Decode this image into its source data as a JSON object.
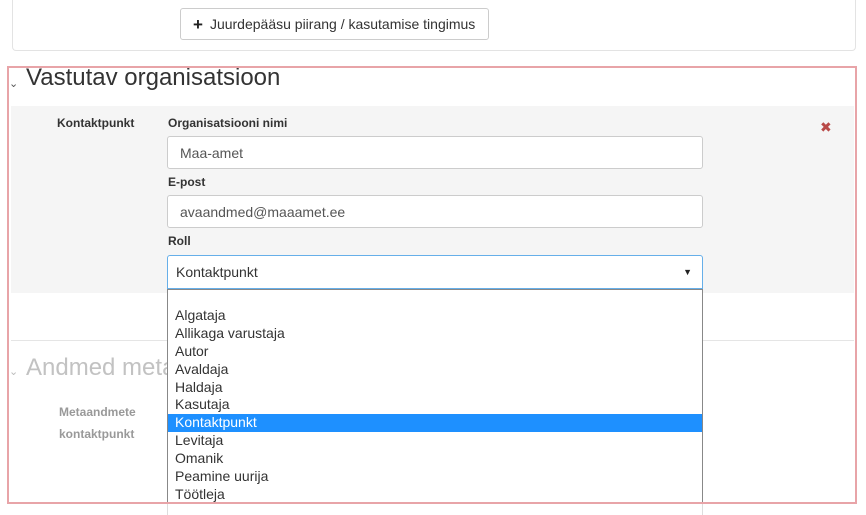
{
  "access_section": {
    "add_button_label": "Juurdepääsu piirang / kasutamise tingimus"
  },
  "responsible_org": {
    "title": "Vastutav organisatsioon",
    "contact_label": "Kontaktpunkt",
    "org_name_label": "Organisatsiooni nimi",
    "org_name_value": "Maa-amet",
    "email_label": "E-post",
    "email_value": "avaandmed@maaamet.ee",
    "role_label": "Roll",
    "role_selected": "Kontaktpunkt",
    "role_options": [
      "",
      "Algataja",
      "Allikaga varustaja",
      "Autor",
      "Avaldaja",
      "Haldaja",
      "Kasutaja",
      "Kontaktpunkt",
      "Levitaja",
      "Omanik",
      "Peamine uurija",
      "Töötleja"
    ],
    "highlighted_option_index": 7
  },
  "metadata_section": {
    "title_visible": "Andmed meta",
    "contact_label_line1": "Metaandmete",
    "contact_label_line2": "kontaktpunkt"
  },
  "icons": {
    "add": "plus-icon",
    "remove": "remove-icon",
    "collapse": "chevron-down-icon",
    "dropdown": "caret-down-icon"
  },
  "colors": {
    "highlight_border": "#e8a4a8",
    "selected_option": "#1e90ff",
    "remove_icon": "#b94a48",
    "focus_border": "#66afe9"
  }
}
